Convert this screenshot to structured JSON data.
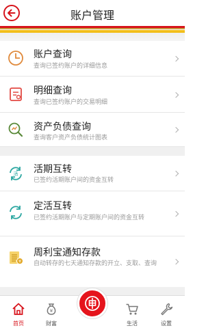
{
  "header": {
    "title": "账户管理",
    "back_icon": "back-arrow-icon"
  },
  "colors": {
    "brand_red": "#d7131b",
    "brand_yellow": "#f2be1a",
    "icon_orange": "#e08a3c",
    "icon_teal": "#2aa6a0",
    "icon_gold": "#d4a72c"
  },
  "menu": {
    "account_query": {
      "title": "账户查询",
      "desc": "查询已签约账户的详细信息",
      "icon": "pie-chart-icon"
    },
    "detail_query": {
      "title": "明细查询",
      "desc": "查询已签约账户的交易明细",
      "icon": "document-icon"
    },
    "asset_query": {
      "title": "资产负债查询",
      "desc": "查询客户资产负债统计图表",
      "icon": "magnifier-chart-icon"
    },
    "current_transfer": {
      "title": "活期互转",
      "desc": "已签约活期账户间的资金互转",
      "icon": "current-transfer-icon"
    },
    "fixed_transfer": {
      "title": "定活互转",
      "desc": "已签约活期账户与定期账户间的资金互转",
      "icon": "fixed-transfer-icon"
    },
    "notice_deposit": {
      "title": "周利宝通知存款",
      "desc": "自动转存的七天通知存款的开立、支取、查询",
      "icon": "coins-icon"
    }
  },
  "tabbar": {
    "home": {
      "label": "首页",
      "icon": "home-icon"
    },
    "wealth": {
      "label": "财富",
      "icon": "money-bag-icon"
    },
    "center": {
      "icon": "bank-logo-icon"
    },
    "life": {
      "label": "生活",
      "icon": "shopping-cart-icon"
    },
    "settings": {
      "label": "设置",
      "icon": "wrench-icon"
    }
  }
}
